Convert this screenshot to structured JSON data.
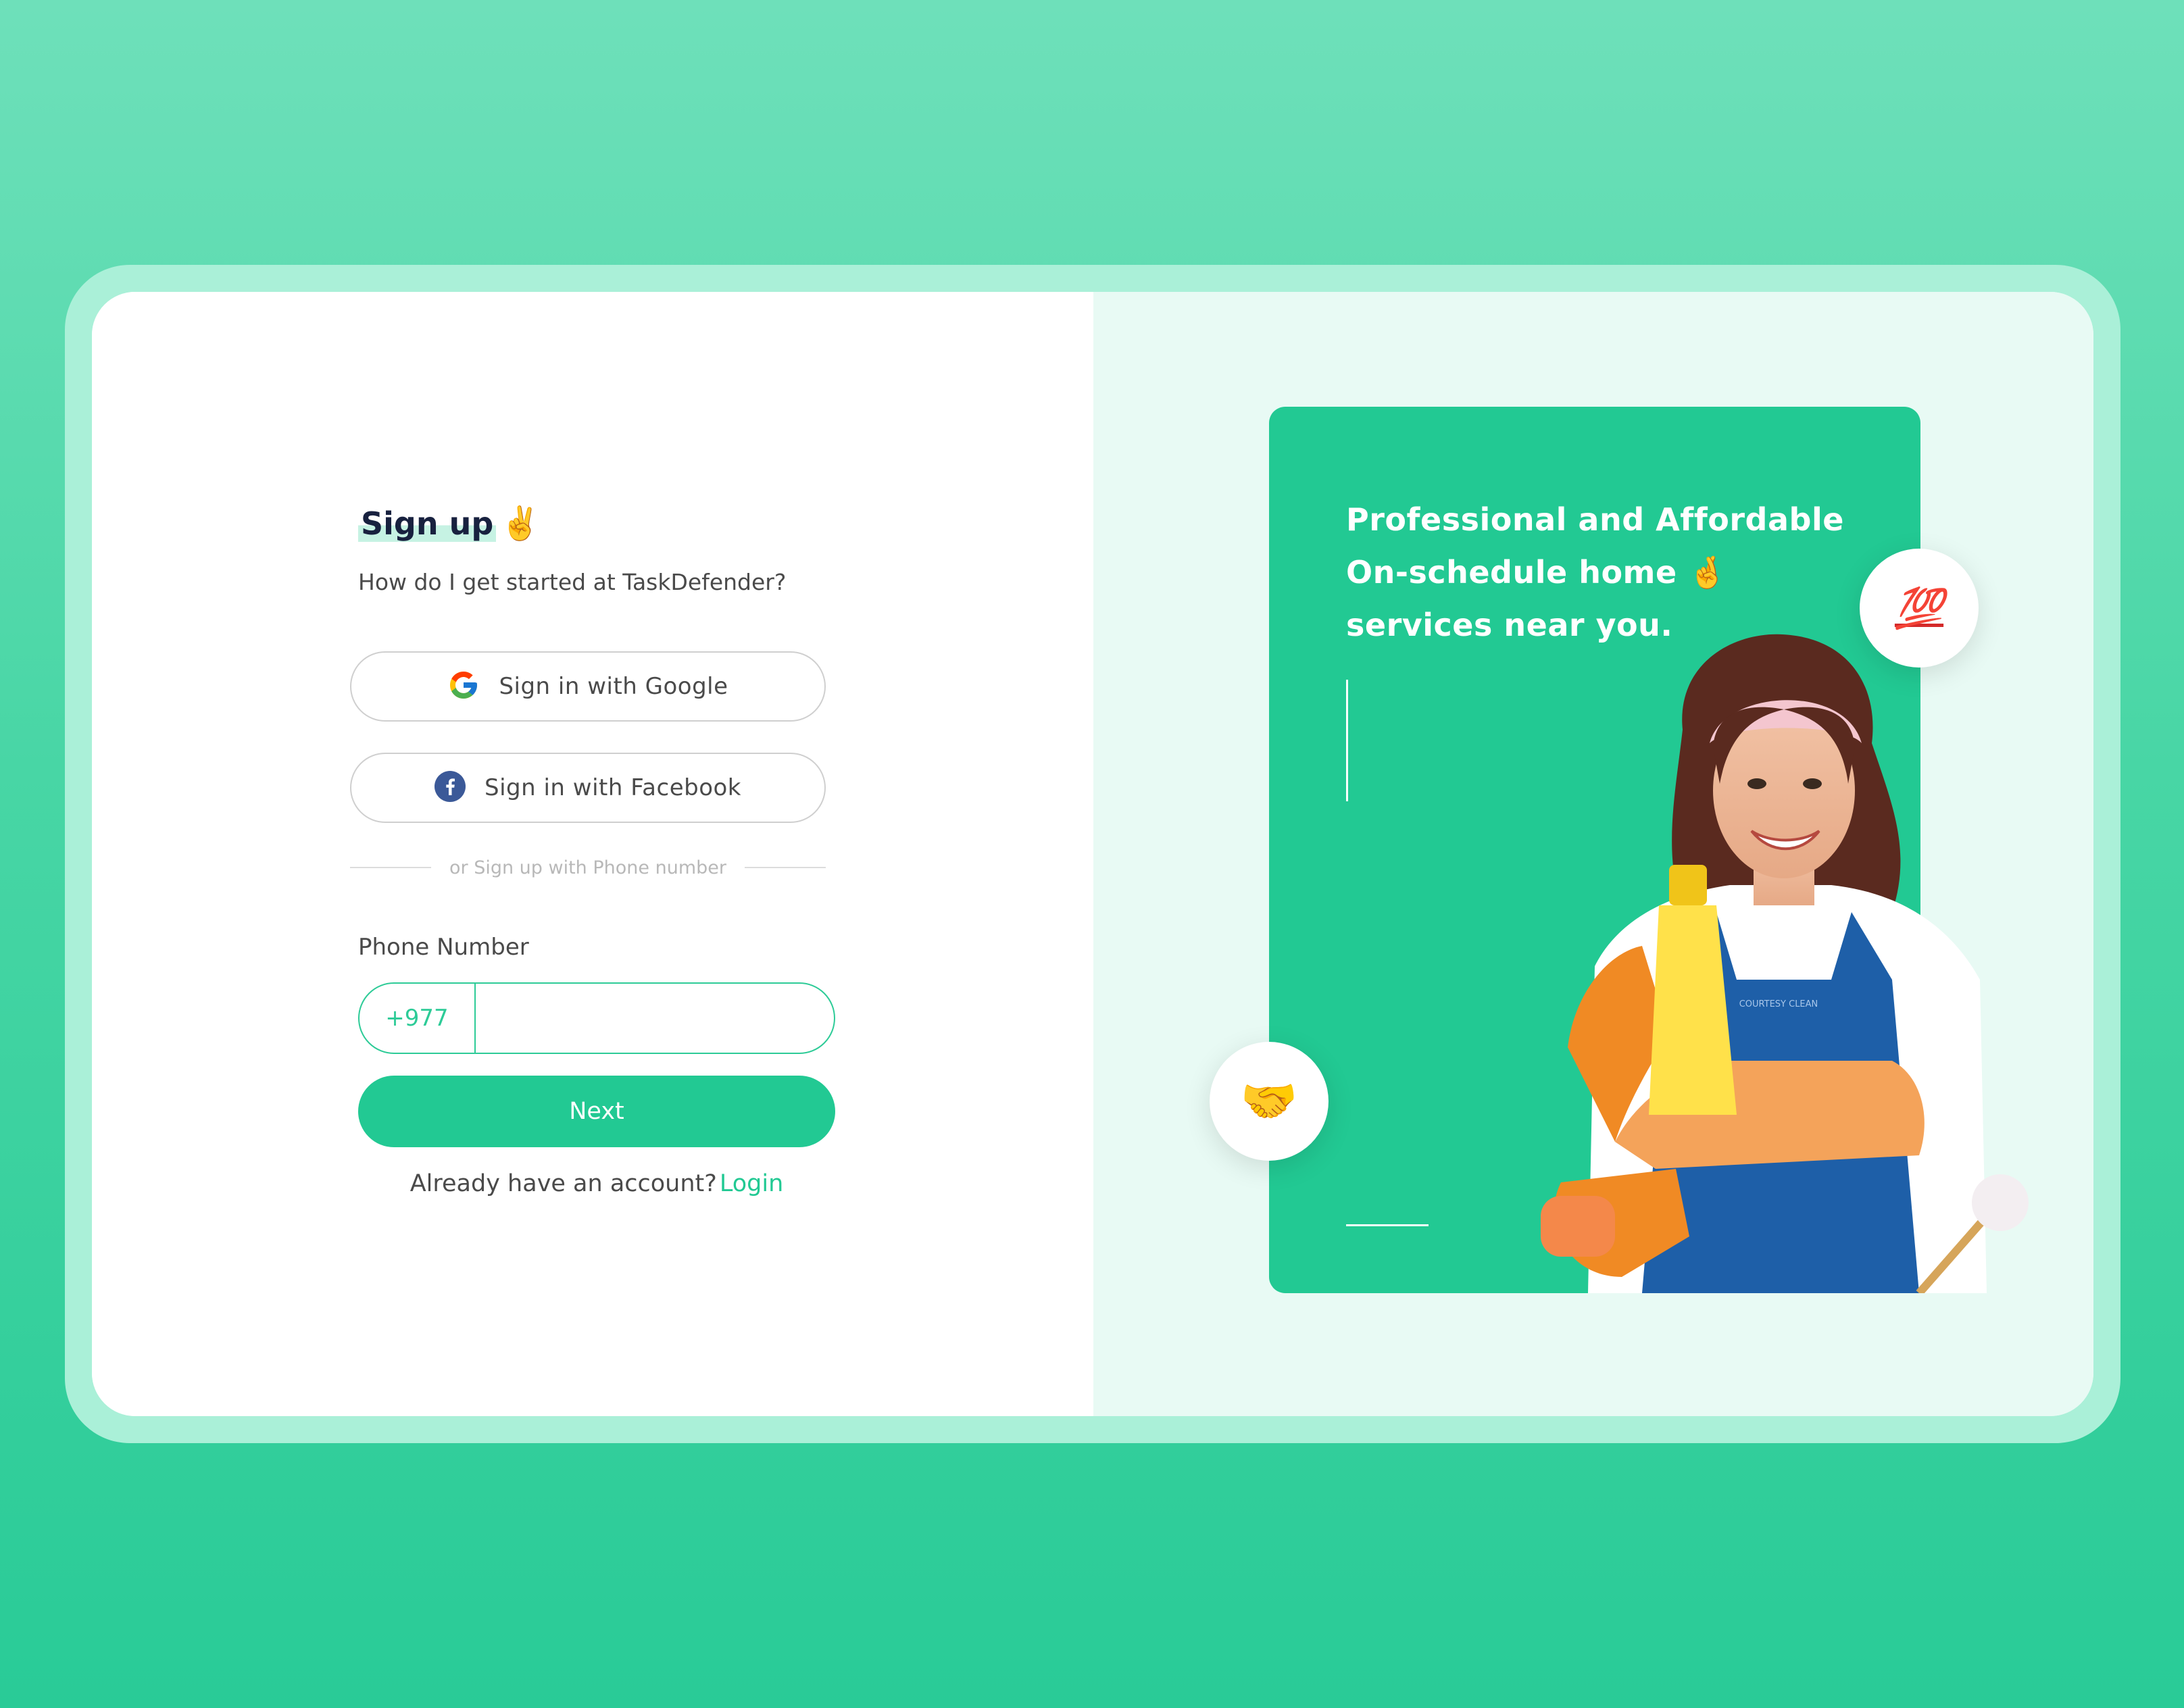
{
  "signup": {
    "title": "Sign up",
    "title_emoji": "✌️",
    "subtitle": "How do I get started at TaskDefender?",
    "google_label": "Sign in with Google",
    "facebook_label": "Sign in with Facebook",
    "divider_text": "or Sign up with Phone number",
    "phone_label": "Phone Number",
    "country_code": "+977",
    "phone_value": "",
    "next_label": "Next",
    "have_account_text": "Already have an account?",
    "login_label": "Login"
  },
  "promo": {
    "headline_line1": "Professional and Affordable",
    "headline_line2": "On-schedule home",
    "headline_emoji": "🤞",
    "headline_line3": "services near you.",
    "badge_top": "💯",
    "badge_bottom": "🤝",
    "apron_text": "COURTESY CLEAN"
  },
  "colors": {
    "accent": "#22c993",
    "background_top": "#6ee0ba",
    "background_bottom": "#29cb97",
    "frame": "#aaf0d8",
    "right_panel": "#e8faf4",
    "title_text": "#18213f"
  },
  "icons": {
    "google": "google-g-icon",
    "facebook": "facebook-f-icon"
  }
}
